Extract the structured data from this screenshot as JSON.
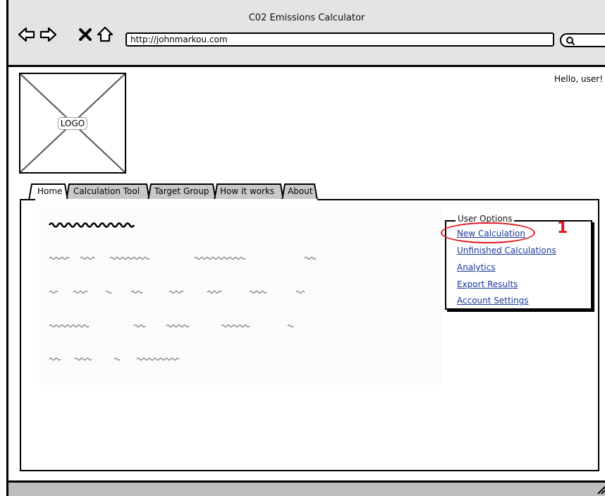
{
  "window": {
    "title": "C02 Emissions Calculator"
  },
  "browser": {
    "url": "http://johnmarkou.com",
    "nav_icons": [
      "back-arrow-icon",
      "forward-arrow-icon",
      "close-x-icon",
      "home-icon"
    ],
    "search_icon": "search-icon"
  },
  "header": {
    "greeting": "Hello, user!",
    "logo_label": "LOGO"
  },
  "tabs": [
    {
      "label": "Home",
      "active": true
    },
    {
      "label": "Calculation Tool",
      "active": false
    },
    {
      "label": "Target Group",
      "active": false
    },
    {
      "label": "How it works",
      "active": false
    },
    {
      "label": "About",
      "active": false
    }
  ],
  "user_options": {
    "legend": "User Options",
    "links": [
      "New Calculation",
      "Unfinished Calculations",
      "Analytics",
      "Export Results",
      "Account Settings"
    ],
    "annotation": "1",
    "highlight_color": "#e0161e",
    "link_color": "#1a3a9a"
  }
}
